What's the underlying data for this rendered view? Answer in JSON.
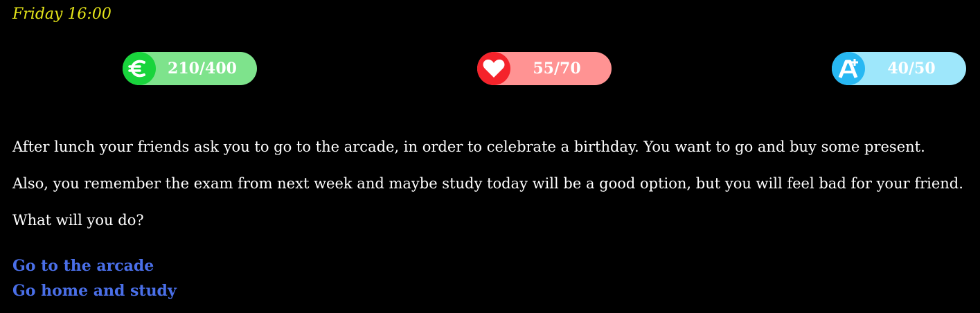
{
  "header": {
    "time": "Friday 16:00"
  },
  "stats": {
    "money": {
      "icon": "euro-icon",
      "value": "210/400",
      "current": 210,
      "max": 400,
      "color": "#19d43c"
    },
    "health": {
      "icon": "heart-icon",
      "value": "55/70",
      "current": 55,
      "max": 70,
      "color": "#f5232b"
    },
    "grade": {
      "icon": "grade-a-plus-icon",
      "value": "40/50",
      "current": 40,
      "max": 50,
      "color": "#27b8f3"
    }
  },
  "story": {
    "paragraphs": [
      "After lunch your friends ask you to go to the arcade, in order to celebrate a birthday. You want to go and buy some present.",
      "Also, you remember the exam from next week and maybe study today will be a good option, but you will feel bad for your friend.",
      "What will you do?"
    ]
  },
  "choices": [
    {
      "label": "Go to the arcade"
    },
    {
      "label": "Go home and study"
    }
  ],
  "colors": {
    "background": "#000000",
    "time_text": "#e6e619",
    "link": "#4a6fe8"
  }
}
